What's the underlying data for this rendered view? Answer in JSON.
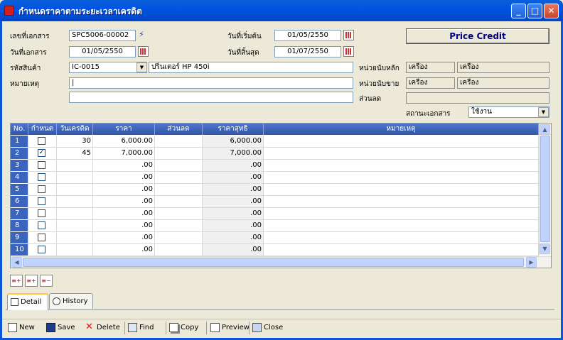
{
  "window": {
    "title": "กำหนดราคาตามระยะเวลาเครดิต"
  },
  "header": {
    "badge": "Price Credit"
  },
  "form": {
    "doc_no_label": "เลขที่เอกสาร",
    "doc_no": "SPC5006-00002",
    "doc_date_label": "วันที่เอกสาร",
    "doc_date": "01/05/2550",
    "start_date_label": "วันที่เริ่มต้น",
    "start_date": "01/05/2550",
    "end_date_label": "วันที่สิ้นสุด",
    "end_date": "01/07/2550",
    "product_code_label": "รหัสสินค้า",
    "product_code": "IC-0015",
    "product_name": "ปริ้นเตอร์ HP  450i",
    "remark_label": "หมายเหตุ",
    "remark": "|",
    "remark2": "",
    "main_unit_label": "หน่วยนับหลัก",
    "main_unit_1": "เครื่อง",
    "main_unit_2": "เครื่อง",
    "sale_unit_label": "หน่วยนับขาย",
    "sale_unit_1": "เครื่อง",
    "sale_unit_2": "เครื่อง",
    "discount_label": "ส่วนลด",
    "discount": "",
    "status_label": "สถานะเอกสาร",
    "status": "ใช้งาน"
  },
  "grid": {
    "columns": [
      "No.",
      "กำหนด",
      "วันเครดิต",
      "ราคา",
      "ส่วนลด",
      "ราคาสุทธิ",
      "หมายเหตุ"
    ],
    "rows": [
      {
        "no": "1",
        "checked": false,
        "days": "30",
        "price": "6,000.00",
        "discount": "",
        "net": "6,000.00",
        "note": ""
      },
      {
        "no": "2",
        "checked": true,
        "days": "45",
        "price": "7,000.00",
        "discount": "",
        "net": "7,000.00",
        "note": ""
      },
      {
        "no": "3",
        "checked": false,
        "days": "",
        "price": ".00",
        "discount": "",
        "net": ".00",
        "note": ""
      },
      {
        "no": "4",
        "checked": false,
        "days": "",
        "price": ".00",
        "discount": "",
        "net": ".00",
        "note": ""
      },
      {
        "no": "5",
        "checked": false,
        "days": "",
        "price": ".00",
        "discount": "",
        "net": ".00",
        "note": ""
      },
      {
        "no": "6",
        "checked": false,
        "days": "",
        "price": ".00",
        "discount": "",
        "net": ".00",
        "note": ""
      },
      {
        "no": "7",
        "checked": false,
        "days": "",
        "price": ".00",
        "discount": "",
        "net": ".00",
        "note": ""
      },
      {
        "no": "8",
        "checked": false,
        "days": "",
        "price": ".00",
        "discount": "",
        "net": ".00",
        "note": ""
      },
      {
        "no": "9",
        "checked": false,
        "days": "",
        "price": ".00",
        "discount": "",
        "net": ".00",
        "note": ""
      },
      {
        "no": "10",
        "checked": false,
        "days": "",
        "price": ".00",
        "discount": "",
        "net": ".00",
        "note": ""
      }
    ],
    "check_mark": "✓"
  },
  "tabs": {
    "detail": "Detail",
    "history": "History"
  },
  "toolbar": {
    "new": "New",
    "save": "Save",
    "delete": "Delete",
    "find": "Find",
    "copy": "Copy",
    "preview": "Preview",
    "close": "Close"
  },
  "colors": {
    "title_bar": "#0054e3",
    "grid_header": "#3a64bd",
    "badge_text": "#000080"
  }
}
